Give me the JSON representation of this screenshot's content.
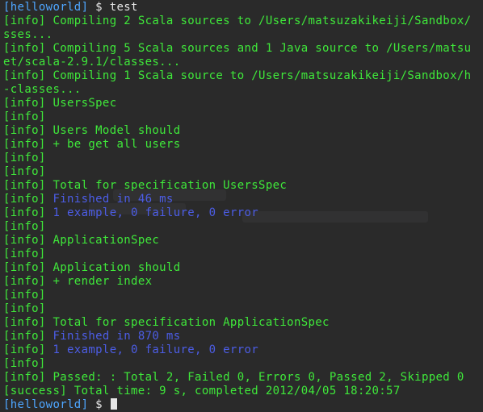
{
  "prompt": {
    "dir": "[helloworld]",
    "symbol": "$"
  },
  "lines": [
    {
      "kind": "prompt",
      "cmd": "test"
    },
    {
      "kind": "log",
      "tag": "[info]",
      "text": "Compiling 2 Scala sources to /Users/matsuzakikeiji/Sandbox/",
      "color": "green"
    },
    {
      "kind": "raw",
      "text": "sses...",
      "color": "green"
    },
    {
      "kind": "log",
      "tag": "[info]",
      "text": "Compiling 5 Scala sources and 1 Java source to /Users/matsu",
      "color": "green"
    },
    {
      "kind": "raw",
      "text": "et/scala-2.9.1/classes...",
      "color": "green"
    },
    {
      "kind": "log",
      "tag": "[info]",
      "text": "Compiling 1 Scala source to /Users/matsuzakikeiji/Sandbox/h",
      "color": "green"
    },
    {
      "kind": "raw",
      "text": "-classes...",
      "color": "green"
    },
    {
      "kind": "log",
      "tag": "[info]",
      "text": "UsersSpec",
      "color": "green"
    },
    {
      "kind": "log",
      "tag": "[info]",
      "text": "",
      "color": "green"
    },
    {
      "kind": "log",
      "tag": "[info]",
      "text": "Users Model should",
      "color": "green"
    },
    {
      "kind": "log",
      "tag": "[info]",
      "text": "+ be get all users",
      "color": "green"
    },
    {
      "kind": "log",
      "tag": "[info]",
      "text": "",
      "color": "green"
    },
    {
      "kind": "log",
      "tag": "[info]",
      "text": "",
      "color": "green"
    },
    {
      "kind": "log",
      "tag": "[info]",
      "text": "Total for specification UsersSpec",
      "color": "green"
    },
    {
      "kind": "log",
      "tag": "[info]",
      "text": "Finished in 46 ms",
      "color": "blue"
    },
    {
      "kind": "log",
      "tag": "[info]",
      "text": "1 example, 0 failure, 0 error",
      "color": "blue"
    },
    {
      "kind": "log",
      "tag": "[info]",
      "text": "",
      "color": "green"
    },
    {
      "kind": "log",
      "tag": "[info]",
      "text": "ApplicationSpec",
      "color": "green"
    },
    {
      "kind": "log",
      "tag": "[info]",
      "text": "",
      "color": "green"
    },
    {
      "kind": "log",
      "tag": "[info]",
      "text": "Application should",
      "color": "green"
    },
    {
      "kind": "log",
      "tag": "[info]",
      "text": "+ render index",
      "color": "green"
    },
    {
      "kind": "log",
      "tag": "[info]",
      "text": "",
      "color": "green"
    },
    {
      "kind": "log",
      "tag": "[info]",
      "text": "",
      "color": "green"
    },
    {
      "kind": "log",
      "tag": "[info]",
      "text": "Total for specification ApplicationSpec",
      "color": "green"
    },
    {
      "kind": "log",
      "tag": "[info]",
      "text": "Finished in 870 ms",
      "color": "blue"
    },
    {
      "kind": "log",
      "tag": "[info]",
      "text": "1 example, 0 failure, 0 error",
      "color": "blue"
    },
    {
      "kind": "log",
      "tag": "[info]",
      "text": "",
      "color": "green"
    },
    {
      "kind": "log",
      "tag": "[info]",
      "text": "Passed: : Total 2, Failed 0, Errors 0, Passed 2, Skipped 0",
      "color": "green"
    },
    {
      "kind": "log",
      "tag": "[success]",
      "text": "Total time: 9 s, completed 2012/04/05 18:20:57",
      "color": "green"
    },
    {
      "kind": "prompt",
      "cmd": ""
    }
  ],
  "colors": {
    "background": "#2a2a2a",
    "green": "#3fe83a",
    "blue": "#4c5de6",
    "prompt_dir": "#4ea6ff",
    "foreground": "#e6e6e6"
  }
}
